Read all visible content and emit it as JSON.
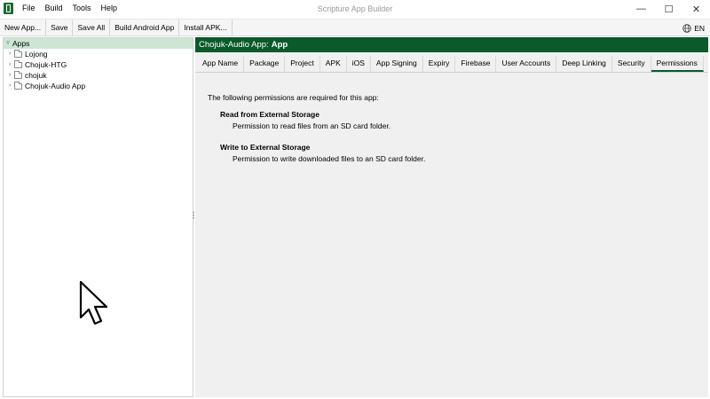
{
  "window": {
    "title": "Scripture App Builder",
    "controls": [
      "minimize-icon",
      "maximize-icon",
      "close-icon"
    ]
  },
  "menu": [
    "File",
    "Build",
    "Tools",
    "Help"
  ],
  "toolbar": {
    "buttons": [
      "New App...",
      "Save",
      "Save All",
      "Build Android App",
      "Install APK..."
    ],
    "language": "EN"
  },
  "tree": {
    "root": "Apps",
    "items": [
      "Lojong",
      "Chojuk-HTG",
      "chojuk",
      "Chojuk-Audio App"
    ]
  },
  "panel": {
    "header_prefix": "Chojuk-Audio App:",
    "header_section": "App",
    "tabs": [
      "App Name",
      "Package",
      "Project",
      "APK",
      "iOS",
      "App Signing",
      "Expiry",
      "Firebase",
      "User Accounts",
      "Deep Linking",
      "Security",
      "Permissions"
    ],
    "active_tab": "Permissions"
  },
  "permissions": {
    "intro": "The following permissions are required for this app:",
    "items": [
      {
        "title": "Read from External Storage",
        "description": "Permission to read files from an SD card folder."
      },
      {
        "title": "Write to External Storage",
        "description": "Permission to write downloaded files to an SD card folder."
      }
    ]
  },
  "colors": {
    "accent": "#0a5a2a",
    "selection": "#cde6d4",
    "panel_bg": "#f0f0f0"
  }
}
